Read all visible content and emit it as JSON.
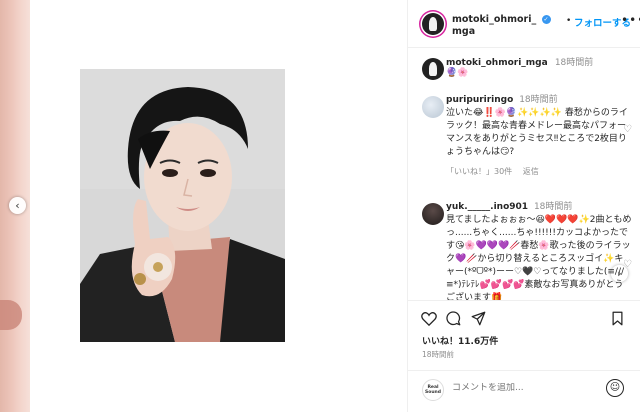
{
  "header": {
    "username_line1": "motoki_ohmori_",
    "username_line2": "mga",
    "follow_dot": "•",
    "follow_label": "フォローする",
    "more_icon": "•••",
    "verified_icon": "✓"
  },
  "caption": {
    "username": "motoki_ohmori_mga",
    "time": "18時間前",
    "text": "🔮🌸"
  },
  "comments": [
    {
      "username": "puripuriringo",
      "time": "18時間前",
      "text": "泣いた😂‼️🌸🔮✨✨✨✨ 春愁からのライラック！最高な青春メドレー最高なパフォーマンスをありがとうミセス‼ところで2枚目りょうちゃんは😏?",
      "likes": "「いいね！」30件",
      "reply": "返信"
    },
    {
      "username": "yuk._____.ino901",
      "time": "18時間前",
      "text": "見てましたよぉぉぉ〜😆❤️❤️❤️✨2曲ともめっ......ちゃく......ちゃ!!!!!!カッコよかったです😘🌸💜💜💜🥢春愁🌸歌った後のライラック💜🥢から切り替えるところスッゴイ✨キャー(*ºᗜº*)ーー♡🖤♡ってなりました(≡///≡*)ﾃﾚﾃﾚ💕💕💕💕素敵なお写真ありがとうございます🎁"
    }
  ],
  "actions": {
    "like_icon": "heart-icon",
    "comment_icon": "comment-icon",
    "share_icon": "share-icon",
    "save_icon": "bookmark-icon",
    "likes_count": "いいね！11.6万件",
    "time": "18時間前"
  },
  "comment_input": {
    "placeholder": "コメントを追加...",
    "avatar_label": "Real Sound",
    "emoji_icon": "☺"
  },
  "nav": {
    "prev_icon": "‹",
    "next_icon": "›"
  }
}
